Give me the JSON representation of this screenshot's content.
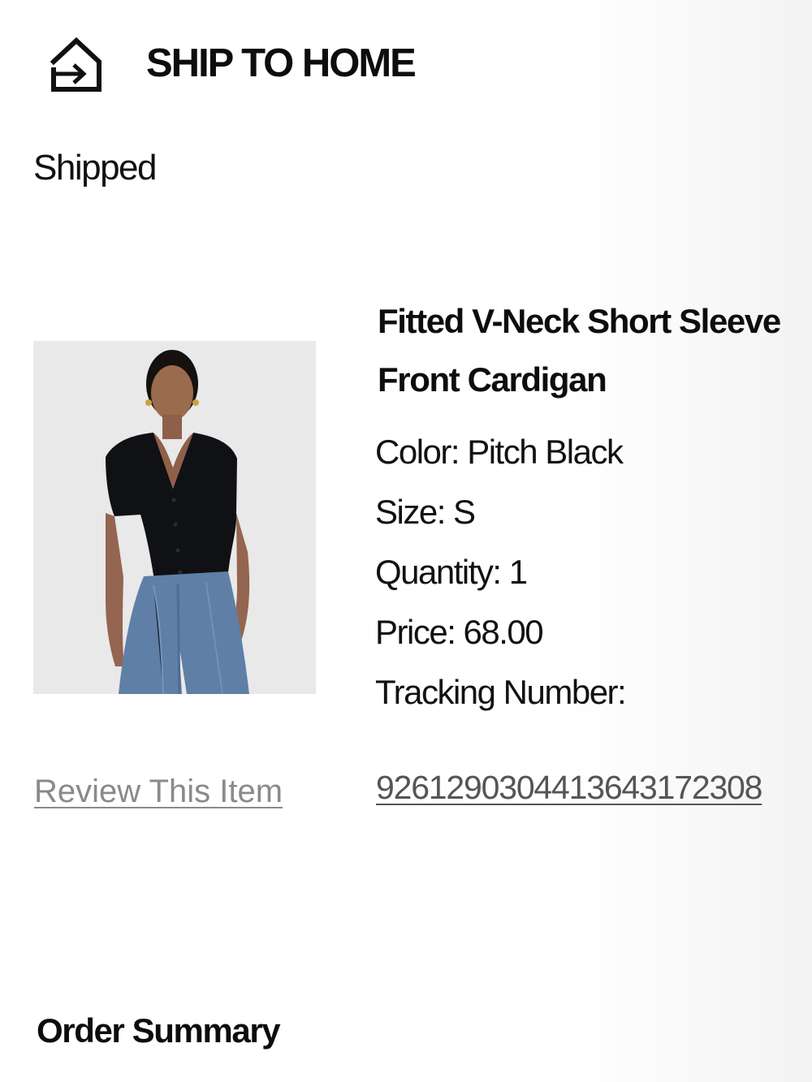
{
  "shipping": {
    "icon": "home-arrow-icon",
    "title": "SHIP TO HOME",
    "status": "Shipped"
  },
  "item": {
    "name_line1": "Fitted V-Neck Short Sleeve",
    "name_line2": "Front Cardigan",
    "color": "Color: Pitch Black",
    "size": "Size: S",
    "quantity": "Quantity: 1",
    "price": "Price: 68.00",
    "tracking_label": "Tracking Number:",
    "tracking_number": "9261290304413643172308",
    "review_link": "Review This Item",
    "image_alt": "Model wearing black cardigan and blue jeans"
  },
  "summary": {
    "title": "Order Summary"
  },
  "colors": {
    "background": "#ffffff",
    "text": "#111111",
    "muted_link": "#8a8a8a",
    "tracking_link": "#555555",
    "cardigan": "#101114",
    "jeans": "#5f7fa7"
  }
}
